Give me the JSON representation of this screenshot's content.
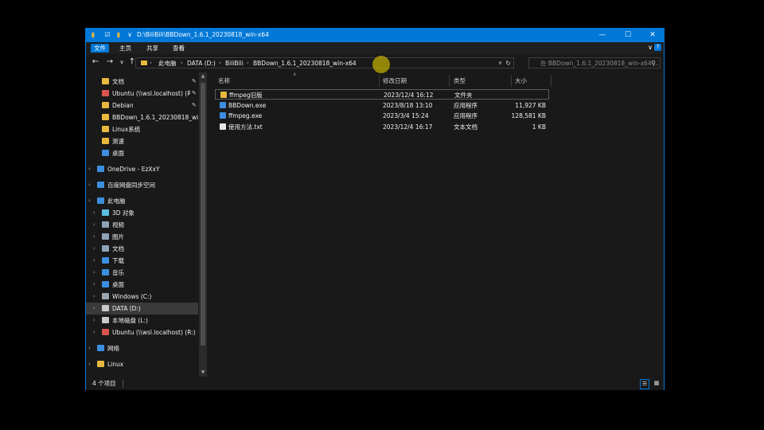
{
  "window": {
    "title": "D:\\BiliBili\\BBDown_1.6.1_20230818_win-x64",
    "accent": "#0078d7",
    "controls": {
      "minimize": "—",
      "maximize": "☐",
      "close": "✕"
    }
  },
  "ribbon": {
    "tabs": [
      "文件",
      "主页",
      "共享",
      "查看"
    ],
    "active_tab": "文件",
    "collapse_glyph": "∨",
    "help_glyph": "?"
  },
  "address": {
    "crumbs": [
      "此电脑",
      "DATA (D:)",
      "BiliBili",
      "BBDown_1.6.1_20230818_win-x64"
    ],
    "search_placeholder": "在 BBDown_1.6.1_20230818_win-x64 ..."
  },
  "nav": {
    "items": [
      {
        "label": "文档",
        "icon": "documents-icon",
        "color": "#e8b83e",
        "pinned": true,
        "indent": 1
      },
      {
        "label": "Ubuntu (\\\\wsl.localhost) (R:)",
        "icon": "network-drive-icon",
        "color": "#d9534f",
        "pinned": true,
        "indent": 1
      },
      {
        "label": "Debian",
        "icon": "folder-icon",
        "color": "#e8b83e",
        "pinned": true,
        "indent": 1
      },
      {
        "label": "BBDown_1.6.1_20230818_win-x64",
        "icon": "folder-icon",
        "color": "#e8b83e",
        "pinned": false,
        "indent": 1
      },
      {
        "label": "Linux系统",
        "icon": "folder-icon",
        "color": "#e8b83e",
        "pinned": false,
        "indent": 1
      },
      {
        "label": "测速",
        "icon": "folder-icon",
        "color": "#e8b83e",
        "pinned": false,
        "indent": 1
      },
      {
        "label": "桌面",
        "icon": "desktop-icon",
        "color": "#3c8fe0",
        "pinned": false,
        "indent": 1
      },
      {
        "label": "",
        "spacer": true
      },
      {
        "label": "OneDrive - EzXxY",
        "icon": "onedrive-icon",
        "color": "#3c8fe0",
        "pinned": false,
        "indent": 0,
        "expander": true
      },
      {
        "label": "",
        "spacer": true
      },
      {
        "label": "百度网盘同步空间",
        "icon": "baidu-netdisk-icon",
        "color": "#3c8fe0",
        "pinned": false,
        "indent": 0,
        "expander": true
      },
      {
        "label": "",
        "spacer": true
      },
      {
        "label": "此电脑",
        "icon": "this-pc-icon",
        "color": "#3c8fe0",
        "pinned": false,
        "indent": 0,
        "expander": true
      },
      {
        "label": "3D 对象",
        "icon": "3d-objects-icon",
        "color": "#5bc0de",
        "pinned": false,
        "indent": 1,
        "expander": true
      },
      {
        "label": "视频",
        "icon": "videos-icon",
        "color": "#8fa3b8",
        "pinned": false,
        "indent": 1,
        "expander": true
      },
      {
        "label": "图片",
        "icon": "pictures-icon",
        "color": "#8fa3b8",
        "pinned": false,
        "indent": 1,
        "expander": true
      },
      {
        "label": "文档",
        "icon": "documents-icon",
        "color": "#8fa3b8",
        "pinned": false,
        "indent": 1,
        "expander": true
      },
      {
        "label": "下载",
        "icon": "downloads-icon",
        "color": "#3c8fe0",
        "pinned": false,
        "indent": 1,
        "expander": true
      },
      {
        "label": "音乐",
        "icon": "music-icon",
        "color": "#3c8fe0",
        "pinned": false,
        "indent": 1,
        "expander": true
      },
      {
        "label": "桌面",
        "icon": "desktop-icon",
        "color": "#3c8fe0",
        "pinned": false,
        "indent": 1,
        "expander": true
      },
      {
        "label": "Windows (C:)",
        "icon": "drive-c-icon",
        "color": "#9aa4ad",
        "pinned": false,
        "indent": 1,
        "expander": true
      },
      {
        "label": "DATA (D:)",
        "icon": "drive-icon",
        "color": "#c9c9c9",
        "pinned": false,
        "indent": 1,
        "expander": true,
        "selected": true
      },
      {
        "label": "本地磁盘 (L:)",
        "icon": "drive-icon",
        "color": "#c9c9c9",
        "pinned": false,
        "indent": 1,
        "expander": true
      },
      {
        "label": "Ubuntu (\\\\wsl.localhost) (R:)",
        "icon": "network-drive-icon",
        "color": "#d9534f",
        "pinned": false,
        "indent": 1,
        "expander": true
      },
      {
        "label": "",
        "spacer": true
      },
      {
        "label": "网络",
        "icon": "network-icon",
        "color": "#3c8fe0",
        "pinned": false,
        "indent": 0,
        "expander": true
      },
      {
        "label": "",
        "spacer": true
      },
      {
        "label": "Linux",
        "icon": "linux-icon",
        "color": "#e8b83e",
        "pinned": false,
        "indent": 0,
        "expander": true
      }
    ]
  },
  "files": {
    "columns": [
      "名称",
      "修改日期",
      "类型",
      "大小"
    ],
    "rows": [
      {
        "name": "ffmpeg旧版",
        "date": "2023/12/4 16:12",
        "type": "文件夹",
        "size": "",
        "icon": "folder-icon",
        "color": "#e8b83e"
      },
      {
        "name": "BBDown.exe",
        "date": "2023/8/18 13:10",
        "type": "应用程序",
        "size": "11,927 KB",
        "icon": "exe-icon",
        "color": "#3c8fe0"
      },
      {
        "name": "ffmpeg.exe",
        "date": "2023/3/4 15:24",
        "type": "应用程序",
        "size": "128,581 KB",
        "icon": "exe-icon",
        "color": "#3c8fe0"
      },
      {
        "name": "使用方法.txt",
        "date": "2023/12/4 16:17",
        "type": "文本文档",
        "size": "1 KB",
        "icon": "text-file-icon",
        "color": "#e6e6e6"
      }
    ]
  },
  "status": {
    "count": "4 个项目"
  }
}
